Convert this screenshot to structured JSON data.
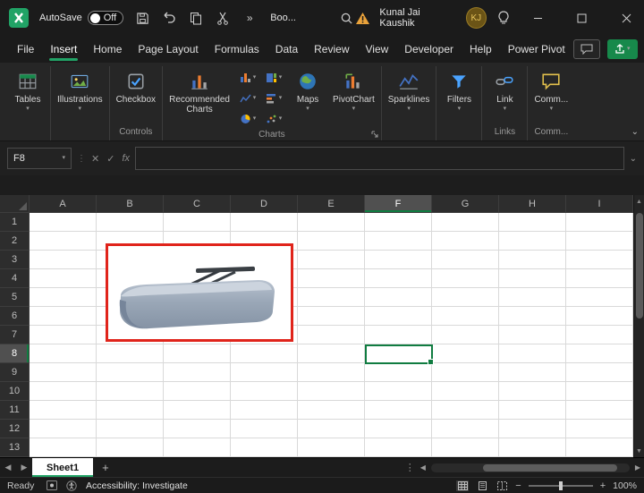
{
  "titlebar": {
    "autosave_label": "AutoSave",
    "autosave_state": "Off",
    "doc_title": "Boo...",
    "user_name": "Kunal Jai Kaushik",
    "user_initials": "KJ"
  },
  "menu": {
    "tabs": [
      {
        "label": "File",
        "active": false
      },
      {
        "label": "Insert",
        "active": true
      },
      {
        "label": "Home",
        "active": false
      },
      {
        "label": "Page Layout",
        "active": false
      },
      {
        "label": "Formulas",
        "active": false
      },
      {
        "label": "Data",
        "active": false
      },
      {
        "label": "Review",
        "active": false
      },
      {
        "label": "View",
        "active": false
      },
      {
        "label": "Developer",
        "active": false
      },
      {
        "label": "Help",
        "active": false
      },
      {
        "label": "Power Pivot",
        "active": false
      }
    ]
  },
  "ribbon": {
    "tables_label": "Tables",
    "illustrations_label": "Illustrations",
    "checkbox_label": "Checkbox",
    "recommended_charts_label": "Recommended Charts",
    "maps_label": "Maps",
    "pivotchart_label": "PivotChart",
    "sparklines_label": "Sparklines",
    "filters_label": "Filters",
    "link_label": "Link",
    "comments_label": "Comm...",
    "group_controls": "Controls",
    "group_charts": "Charts",
    "group_links": "Links",
    "group_comments": "Comm..."
  },
  "formula_bar": {
    "name_box": "F8",
    "fx_label": "fx"
  },
  "grid": {
    "columns": [
      "A",
      "B",
      "C",
      "D",
      "E",
      "F",
      "G",
      "H",
      "I"
    ],
    "rows": [
      "1",
      "2",
      "3",
      "4",
      "5",
      "6",
      "7",
      "8",
      "9",
      "10",
      "11",
      "12",
      "13"
    ],
    "selected_column": "F",
    "selected_row": "8",
    "active_cell": "F8"
  },
  "sheet_bar": {
    "tabs": [
      {
        "label": "Sheet1",
        "active": true
      }
    ]
  },
  "status_bar": {
    "mode": "Ready",
    "accessibility": "Accessibility: Investigate",
    "zoom": "100%"
  }
}
